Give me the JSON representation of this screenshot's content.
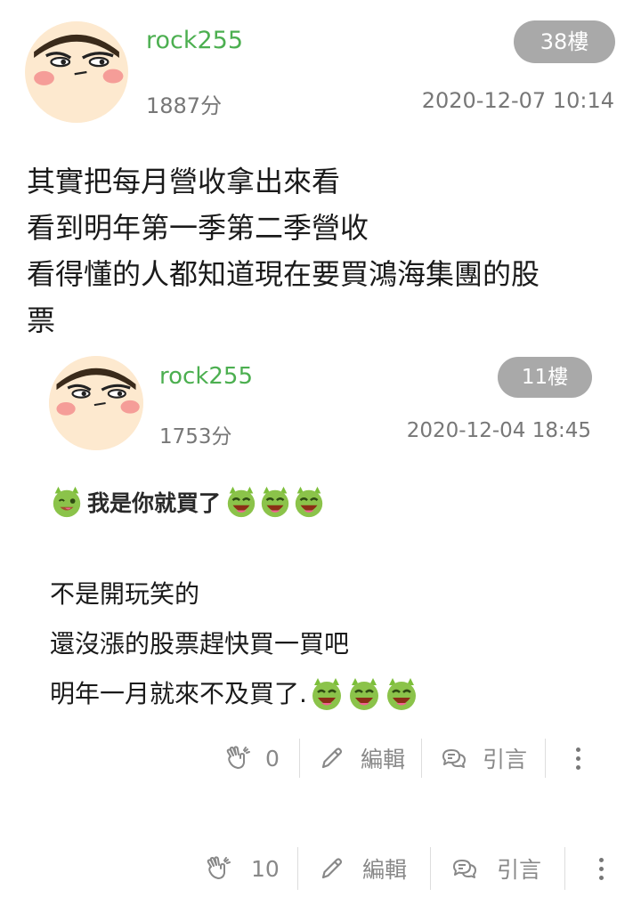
{
  "main_post": {
    "username": "rock255",
    "score": "1887分",
    "datetime": "2020-12-07 10:14",
    "floor": "38樓",
    "lines": [
      "其實把每月營收拿出來看",
      "看到明年第一季第二季營收",
      "看得懂的人都知道現在要買鴻海集團的股",
      "票"
    ],
    "actions": {
      "like_count": "10",
      "edit_label": "編輯",
      "quote_label": "引言"
    }
  },
  "quoted_post": {
    "username": "rock255",
    "score": "1753分",
    "datetime": "2020-12-04 18:45",
    "floor": "11樓",
    "sticker_text": "我是你就買了",
    "lines": [
      "不是開玩笑的",
      "還沒漲的股票趕快買一買吧",
      "明年一月就來不及買了."
    ],
    "actions": {
      "like_count": "0",
      "edit_label": "編輯",
      "quote_label": "引言"
    }
  },
  "icons": {
    "like": "clap-hands-icon",
    "edit": "pencil-icon",
    "quote": "chat-bubbles-icon",
    "more": "vertical-dots-icon",
    "emoji": "green-grin-emoji-icon",
    "emoji_wink": "green-wink-emoji-icon"
  },
  "colors": {
    "username": "#4caf50",
    "badge": "#a9a9a9",
    "meta": "#777777"
  }
}
